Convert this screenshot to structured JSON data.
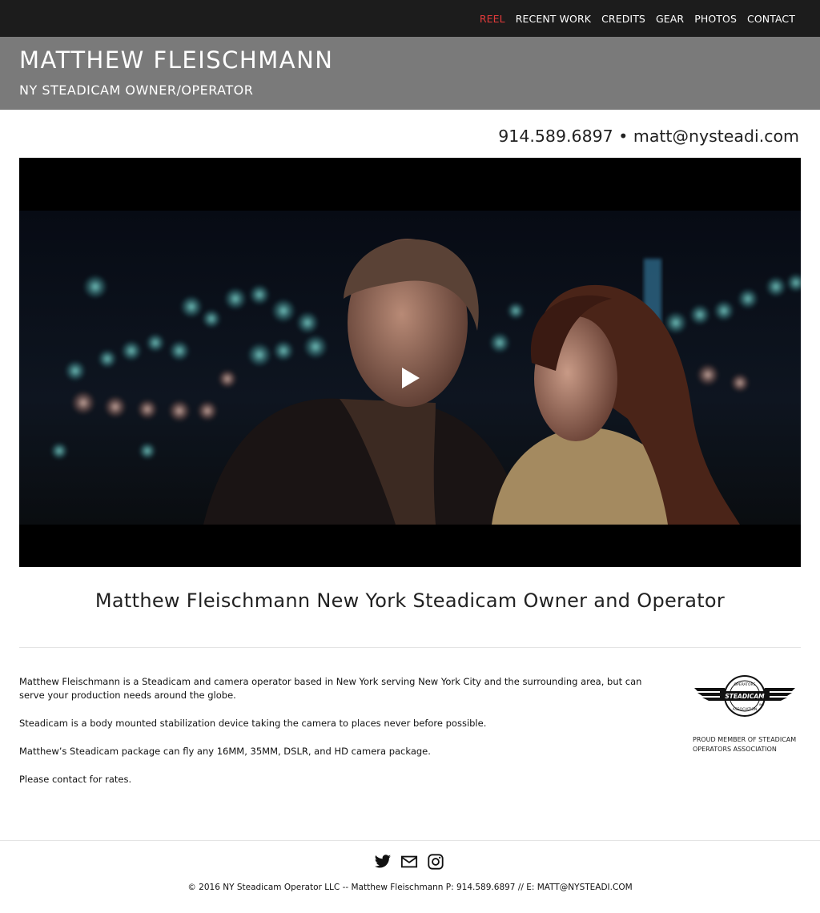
{
  "nav": {
    "items": [
      {
        "label": "REEL",
        "active": true
      },
      {
        "label": "RECENT WORK",
        "active": false
      },
      {
        "label": "CREDITS",
        "active": false
      },
      {
        "label": "GEAR",
        "active": false
      },
      {
        "label": "PHOTOS",
        "active": false
      },
      {
        "label": "CONTACT",
        "active": false
      }
    ],
    "active_color": "#e23b3b"
  },
  "header": {
    "title": "MATTHEW FLEISCHMANN",
    "subtitle": "NY STEADICAM OWNER/OPERATOR"
  },
  "contact": {
    "phone": "914.589.6897",
    "separator": "•",
    "email": "matt@nysteadi.com"
  },
  "video": {
    "play_icon": "play-icon"
  },
  "main": {
    "headline": "Matthew Fleischmann New York Steadicam Owner and Operator",
    "paragraphs": [
      "Matthew Fleischmann is a Steadicam and camera operator based in New York serving New York City and the surrounding area, but can serve your production needs around the globe.",
      "Steadicam is a body mounted stabilization device taking the camera to places never before possible.",
      "Matthew’s Steadicam package can fly any 16MM, 35MM, DSLR, and HD camera package.",
      "Please contact for rates."
    ]
  },
  "badge": {
    "top_text": "OPERATORS",
    "center_text": "STEADICAM",
    "bottom_text": "ASSOCIATION",
    "small_text": "INC",
    "caption": "PROUD MEMBER OF STEADICAM OPERATORS ASSOCIATION"
  },
  "footer": {
    "icons": [
      "twitter-icon",
      "mail-icon",
      "instagram-icon"
    ],
    "copyright": "© 2016 NY Steadicam Operator LLC -- Matthew Fleischmann P: 914.589.6897 // E: MATT@NYSTEADI.COM"
  }
}
